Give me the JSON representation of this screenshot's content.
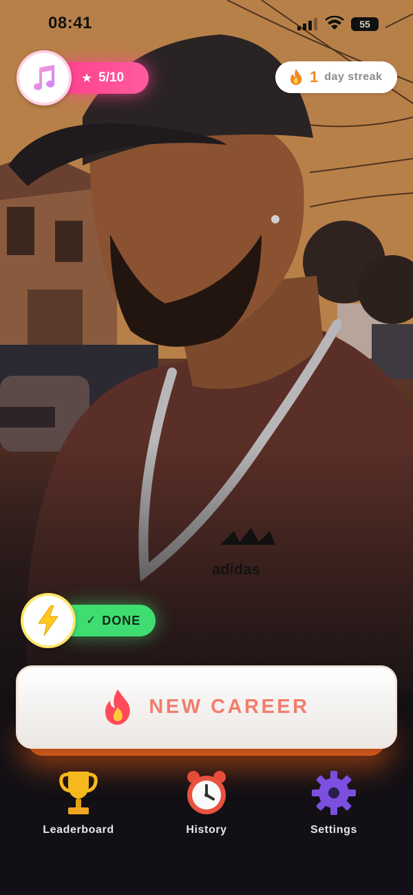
{
  "status_bar": {
    "time": "08:41",
    "battery": "55"
  },
  "top_left_badge": {
    "icon": "music-note-icon",
    "progress_label": "5/10",
    "star_glyph": "★"
  },
  "streak": {
    "count": "1",
    "label": "day streak",
    "icon": "fire-icon"
  },
  "task_status": {
    "icon": "lightning-bolt-icon",
    "check_glyph": "✓",
    "label": "DONE"
  },
  "primary_action": {
    "label": "NEW CAREER",
    "icon": "fire-icon"
  },
  "bottom_nav": {
    "items": [
      {
        "label": "Leaderboard",
        "icon": "trophy-icon"
      },
      {
        "label": "History",
        "icon": "alarm-clock-icon"
      },
      {
        "label": "Settings",
        "icon": "gear-icon"
      }
    ]
  },
  "colors": {
    "music_pill": "#ff4a94",
    "done_pill": "#3fdc72",
    "career_text": "#f27d6e",
    "streak_number": "#f08a1e",
    "gear": "#7b4fe0"
  }
}
